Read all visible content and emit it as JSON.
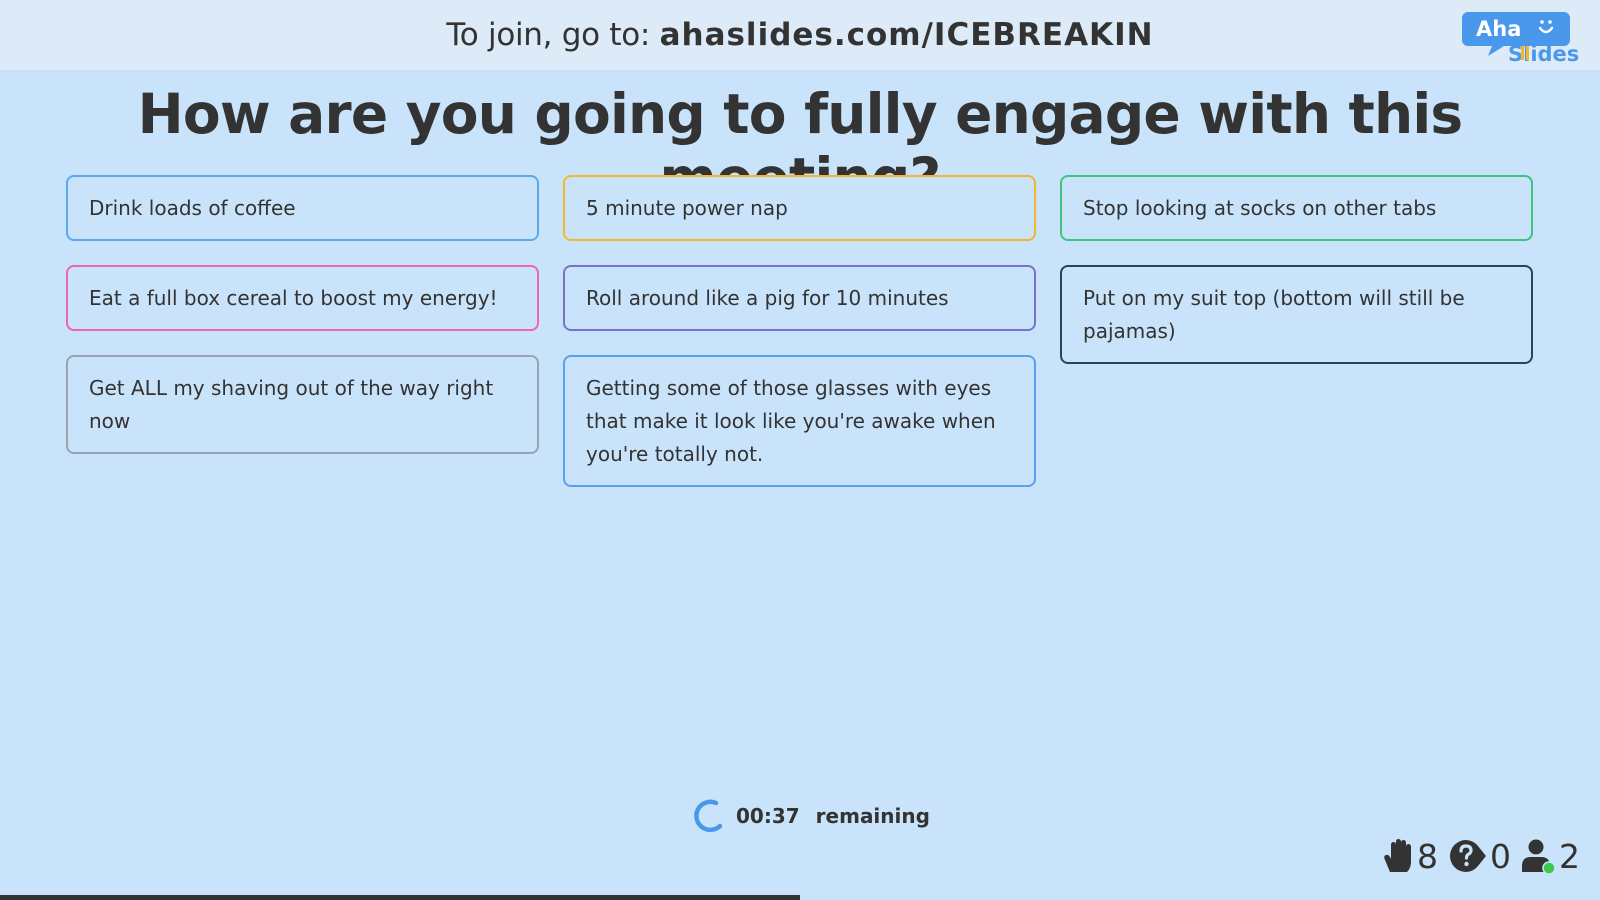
{
  "header": {
    "join_prefix": "To join, go to: ",
    "join_url": "ahaslides.com/ICEBREAKIN",
    "logo": {
      "line1": "Aha",
      "line2": "Slides",
      "icon": "smiley-speech-bubble-icon"
    }
  },
  "question": {
    "title": "How are you going to fully engage with this meeting?"
  },
  "responses": {
    "columns": [
      [
        {
          "text": "Drink loads of coffee",
          "color": "#5aa9ec"
        },
        {
          "text": "Eat a full box cereal to boost my energy!",
          "color": "#ee66a8"
        },
        {
          "text": "Get ALL my shaving out of the way right now",
          "color": "#9aa4b0"
        }
      ],
      [
        {
          "text": "5 minute power nap",
          "color": "#f5b52e"
        },
        {
          "text": "Roll around like a pig for 10 minutes",
          "color": "#7b72c8"
        },
        {
          "text": "Getting some of those glasses with eyes that make it look like you're awake when you're totally not.",
          "color": "#5aa0ee"
        }
      ],
      [
        {
          "text": "Stop looking at socks on other tabs",
          "color": "#3fc47e"
        },
        {
          "text": "Put on my suit top (bottom will still be pajamas)",
          "color": "#1e4a50"
        }
      ]
    ]
  },
  "timer": {
    "time": "00:37",
    "label": "remaining",
    "icon": "spinner-icon",
    "color": "#4a98ec"
  },
  "stats": {
    "reactions": {
      "icon": "raised-hand-icon",
      "value": "8"
    },
    "questions": {
      "icon": "question-bubble-icon",
      "value": "0"
    },
    "participants": {
      "icon": "user-online-icon",
      "value": "2",
      "online_color": "#3cc94a"
    }
  },
  "progress": {
    "fraction": 0.5
  }
}
